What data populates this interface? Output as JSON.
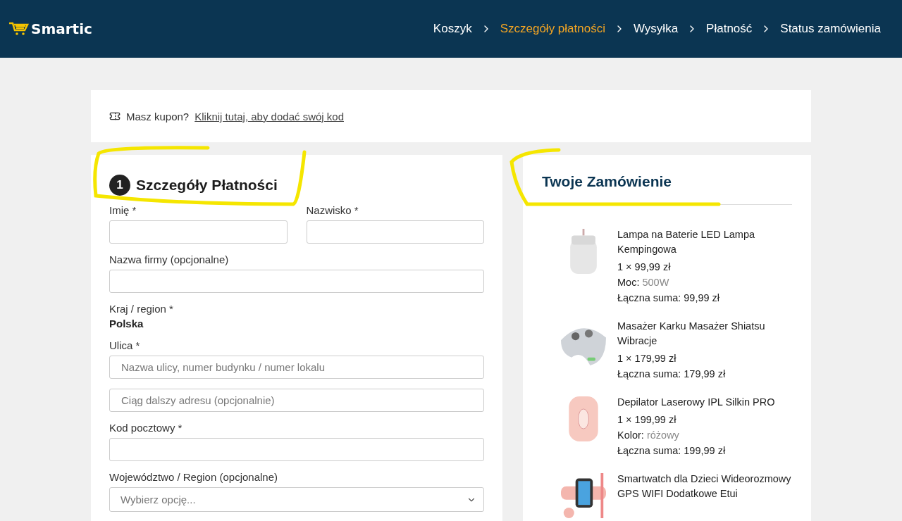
{
  "header": {
    "logo": "Smartic",
    "steps": [
      {
        "label": "Koszyk",
        "selected": false
      },
      {
        "label": "Szczegóły płatności",
        "selected": true
      },
      {
        "label": "Wysyłka",
        "selected": false
      },
      {
        "label": "Płatność",
        "selected": false
      },
      {
        "label": "Status zamówienia",
        "selected": false
      }
    ]
  },
  "coupon": {
    "text": "Masz kupon?",
    "link": "Kliknij tutaj, aby dodać swój kod"
  },
  "billing": {
    "number": "1",
    "title": "Szczegóły Płatności",
    "fields": [
      {
        "kind": "pair",
        "items": [
          {
            "label": "Imię *"
          },
          {
            "label": "Nazwisko *"
          }
        ]
      },
      {
        "kind": "text",
        "label": "Nazwa firmy (opcjonalne)"
      },
      {
        "kind": "static",
        "label": "Kraj / region *",
        "value": "Polska"
      },
      {
        "kind": "text",
        "label": "Ulica *",
        "placeholder": "Nazwa ulicy, numer budynku / numer lokalu"
      },
      {
        "kind": "text",
        "placeholder": "Ciąg dalszy adresu (opcjonalnie)"
      },
      {
        "kind": "text",
        "label": "Kod pocztowy *"
      },
      {
        "kind": "select",
        "label": "Województwo / Region (opcjonalne)",
        "placeholder": "Wybierz opcję..."
      }
    ]
  },
  "order": {
    "title": "Twoje Zamówienie",
    "products": [
      {
        "kind": "lamp",
        "name": "Lampa na Baterie LED Lampa Kempingowa",
        "price": "1 × 99,99 zł",
        "attribute": {
          "label": "Moc:",
          "value": "500W"
        },
        "total": "Łączna suma: 99,99 zł"
      },
      {
        "kind": "massager",
        "name": "Masażer Karku Masażer Shiatsu Wibracje",
        "price": "1 × 179,99 zł",
        "total": "Łączna suma: 179,99 zł"
      },
      {
        "kind": "epilator",
        "name": "Depilator Laserowy IPL Silkin PRO",
        "price": "1 × 199,99 zł",
        "attribute": {
          "label": "Kolor:",
          "value": "różowy"
        },
        "total": "Łączna suma: 199,99 zł"
      },
      {
        "kind": "watch",
        "name": "Smartwatch dla Dzieci Wideorozmowy GPS WIFI Dodatkowe Etui"
      }
    ]
  }
}
